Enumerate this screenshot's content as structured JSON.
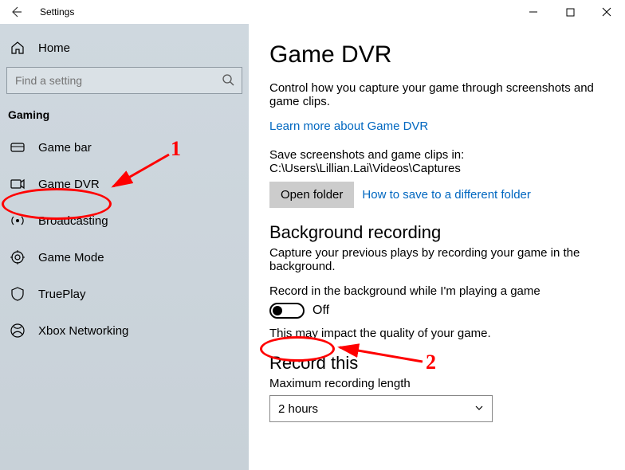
{
  "titlebar": {
    "title": "Settings"
  },
  "sidebar": {
    "home_label": "Home",
    "search_placeholder": "Find a setting",
    "section_title": "Gaming",
    "items": [
      {
        "label": "Game bar"
      },
      {
        "label": "Game DVR"
      },
      {
        "label": "Broadcasting"
      },
      {
        "label": "Game Mode"
      },
      {
        "label": "TruePlay"
      },
      {
        "label": "Xbox Networking"
      }
    ]
  },
  "main": {
    "heading": "Game DVR",
    "description": "Control how you capture your game through screenshots and game clips.",
    "learn_more": "Learn more about Game DVR",
    "save_path": "Save screenshots and game clips in: C:\\Users\\Lillian.Lai\\Videos\\Captures",
    "open_folder": "Open folder",
    "how_to_save": "How to save to a different folder",
    "bg_heading": "Background recording",
    "bg_desc": "Capture your previous plays by recording your game in the background.",
    "bg_toggle_label": "Record in the background while I'm playing a game",
    "bg_toggle_state": "Off",
    "bg_warn": "This may impact the quality of your game.",
    "record_this": "Record this",
    "max_len_label": "Maximum recording length",
    "max_len_value": "2 hours"
  },
  "annotations": {
    "num1": "1",
    "num2": "2"
  }
}
